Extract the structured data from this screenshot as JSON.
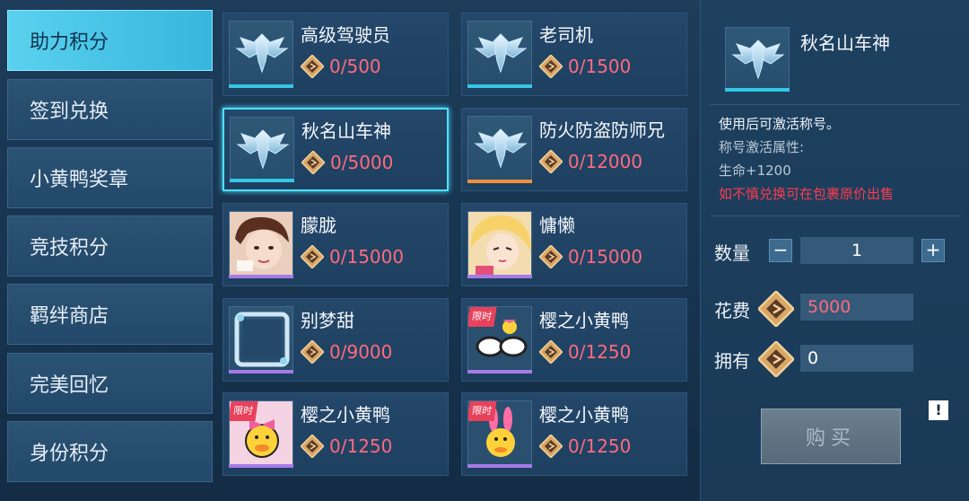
{
  "sidebar": {
    "items": [
      {
        "label": "助力积分",
        "active": true
      },
      {
        "label": "签到兑换"
      },
      {
        "label": "小黄鸭奖章"
      },
      {
        "label": "竞技积分"
      },
      {
        "label": "羁绊商店"
      },
      {
        "label": "完美回忆"
      },
      {
        "label": "身份积分"
      }
    ]
  },
  "grid": {
    "items": [
      {
        "name": "高级驾驶员",
        "cost": "0/500"
      },
      {
        "name": "老司机",
        "cost": "0/1500"
      },
      {
        "name": "秋名山车神",
        "cost": "0/5000"
      },
      {
        "name": "防火防盗防师兄",
        "cost": "0/12000"
      },
      {
        "name": "朦胧",
        "cost": "0/15000"
      },
      {
        "name": "慵懒",
        "cost": "0/15000"
      },
      {
        "name": "别梦甜",
        "cost": "0/9000"
      },
      {
        "name": "樱之小黄鸭",
        "cost": "0/1250",
        "tag": "限时"
      },
      {
        "name": "樱之小黄鸭",
        "cost": "0/1250",
        "tag": "限时"
      },
      {
        "name": "樱之小黄鸭",
        "cost": "0/1250",
        "tag": "限时"
      }
    ]
  },
  "detail": {
    "title": "秋名山车神",
    "line1": "使用后可激活称号。",
    "line2": "称号激活属性:",
    "line3": "生命+1200",
    "warning": "如不慎兑换可在包裹原价出售",
    "quantity_label": "数量",
    "quantity": "1",
    "minus": "−",
    "plus": "+",
    "cost_label": "花费",
    "cost": "5000",
    "own_label": "拥有",
    "own": "0",
    "buy_label": "购买",
    "info": "!"
  },
  "colors": {
    "accent": "#37b6dd",
    "cost_red": "#ff6a7e",
    "warning_red": "#ff3b4e",
    "selected_border": "#4fe0ff"
  }
}
